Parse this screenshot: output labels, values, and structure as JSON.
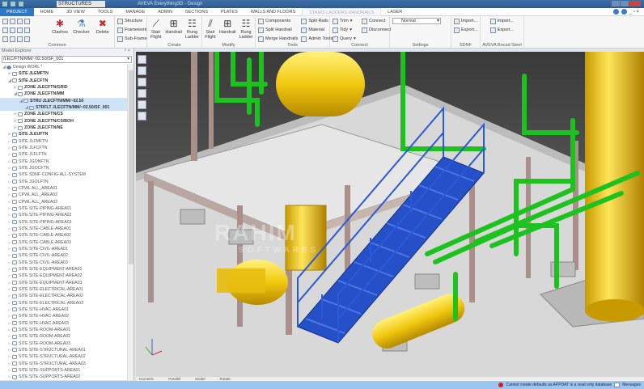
{
  "titlebar": {
    "workspace": "STRUCTURES",
    "title": "AVEVA Everything3D - Design"
  },
  "tabs": [
    "PROJECT",
    "HOME",
    "3D VIEW",
    "TOOLS",
    "MANAGE",
    "ADMIN",
    "SECTIONS",
    "PLATES",
    "WALLS AND FLOORS",
    "STAIRS LADDERS HANDRAILS",
    "LASER"
  ],
  "ribbon": {
    "common": {
      "label": "Common",
      "clashes": "Clashes",
      "checker": "Checker",
      "delete": "Delete"
    },
    "structure": {
      "items": [
        "Structure",
        "Framework",
        "Sub-Frame"
      ]
    },
    "create": {
      "label": "Create",
      "items": [
        "Stair Flight",
        "Handrail",
        "Rung Ladder"
      ]
    },
    "modify": {
      "label": "Modify",
      "items": [
        "Stair Flight",
        "Handrail",
        "Rung Ladder"
      ]
    },
    "tools": {
      "label": "Tools",
      "col1": [
        "Components",
        "Split Handrail",
        "Merge Handrails"
      ],
      "col2": [
        "Split Rails",
        "Material",
        "Admin Tools"
      ]
    },
    "trim": {
      "items": [
        "Trim",
        "Tidy",
        "Query"
      ]
    },
    "connect": {
      "label": "Connect",
      "items": [
        "Connect",
        "Disconnect"
      ]
    },
    "settings": {
      "label": "Settings",
      "value": "Normal"
    },
    "sdnf": {
      "label": "SDNF",
      "items": [
        "Import...",
        "Export..."
      ]
    },
    "bocad": {
      "label": "AVEVA Bocad Steel",
      "items": [
        "Import...",
        "Export..."
      ]
    }
  },
  "explorer": {
    "title": "Model Explorer",
    "path": "/LEC/FTN/MM/~02.50/SF_001",
    "nodes": [
      {
        "label": "Design WORL *",
        "d": 0,
        "b": false
      },
      {
        "label": "SITE JLEMFTN",
        "d": 1,
        "b": true
      },
      {
        "label": "SITE JLECFTN",
        "d": 1,
        "b": true
      },
      {
        "label": "ZONE JLECFTN/GRID",
        "d": 2,
        "b": true
      },
      {
        "label": "ZONE JLECFTN/MM",
        "d": 2,
        "b": true
      },
      {
        "label": "STRU JLECFTN/MM/~02.50",
        "d": 3,
        "b": true,
        "sel": true
      },
      {
        "label": "STRFLT JLECFTN/MM/~02.50/SF_001",
        "d": 4,
        "b": true,
        "sel": true
      },
      {
        "label": "ZONE JLECFTN/CS",
        "d": 2,
        "b": true
      },
      {
        "label": "ZONE JLECFTN/CS/BOH",
        "d": 2,
        "b": true
      },
      {
        "label": "ZONE JLECFTN/NE",
        "d": 2,
        "b": true
      },
      {
        "label": "SITE JLEUFTN",
        "d": 1,
        "b": true
      },
      {
        "label": "SITE JLFMFTN",
        "d": 1
      },
      {
        "label": "SITE JLFCFTN",
        "d": 1
      },
      {
        "label": "SITE JLFLFTN",
        "d": 1
      },
      {
        "label": "SITE JGONFTN",
        "d": 1
      },
      {
        "label": "SITE JGOCFTN",
        "d": 1
      },
      {
        "label": "SITE SDNF-CONFIG-ALL-SYSTEM",
        "d": 1
      },
      {
        "label": "SITE JGOLFTN",
        "d": 1
      },
      {
        "label": "CPWL ALL_AREA01",
        "d": 1
      },
      {
        "label": "CPWL ALL_AREA02",
        "d": 1
      },
      {
        "label": "CPWL ALL_AREA03",
        "d": 1
      },
      {
        "label": "SITE SITE-PIPING-AREA01",
        "d": 1
      },
      {
        "label": "SITE SITE-PIPING-AREA02",
        "d": 1
      },
      {
        "label": "SITE SITE-PIPING-AREA03",
        "d": 1
      },
      {
        "label": "SITE SITE-CABLE-AREA01",
        "d": 1
      },
      {
        "label": "SITE SITE-CABLE-AREA02",
        "d": 1
      },
      {
        "label": "SITE SITE-CABLE-AREA03",
        "d": 1
      },
      {
        "label": "SITE SITE-CIVIL-AREA01",
        "d": 1
      },
      {
        "label": "SITE SITE-CIVIL-AREA02",
        "d": 1
      },
      {
        "label": "SITE SITE-CIVIL-AREA03",
        "d": 1
      },
      {
        "label": "SITE SITE-EQUIPMENT-AREA01",
        "d": 1
      },
      {
        "label": "SITE SITE-EQUIPMENT-AREA02",
        "d": 1
      },
      {
        "label": "SITE SITE-EQUIPMENT-AREA03",
        "d": 1
      },
      {
        "label": "SITE SITE-ELECTRICAL-AREA01",
        "d": 1
      },
      {
        "label": "SITE SITE-ELECTRICAL-AREA02",
        "d": 1
      },
      {
        "label": "SITE SITE-ELECTRICAL-AREA03",
        "d": 1
      },
      {
        "label": "SITE SITE-HVAC-AREA01",
        "d": 1
      },
      {
        "label": "SITE SITE-HVAC-AREA02",
        "d": 1
      },
      {
        "label": "SITE SITE-HVAC-AREA03",
        "d": 1
      },
      {
        "label": "SITE SITE-ROOM-AREA01",
        "d": 1
      },
      {
        "label": "SITE SITE-ROOM-AREA02",
        "d": 1
      },
      {
        "label": "SITE SITE-ROOM-AREA03",
        "d": 1
      },
      {
        "label": "SITE SITE-STRUCTURAL-AREA01",
        "d": 1
      },
      {
        "label": "SITE SITE-STRUCTURAL-AREA02",
        "d": 1
      },
      {
        "label": "SITE SITE-STRUCTURAL-AREA03",
        "d": 1
      },
      {
        "label": "SITE SITE-SUPPORTS-AREA01",
        "d": 1
      },
      {
        "label": "SITE SITE-SUPPORTS-AREA02",
        "d": 1
      }
    ]
  },
  "viewport": {
    "projection": "Isometric",
    "mode": "Parallel",
    "model": "Model",
    "rotate": "Rotate"
  },
  "watermark": {
    "name": "RAHIM",
    "sub": "SOFTWARES"
  },
  "status": {
    "message": "Cannot create defaults as APPDAT is a read only database",
    "messages": "Messages"
  }
}
